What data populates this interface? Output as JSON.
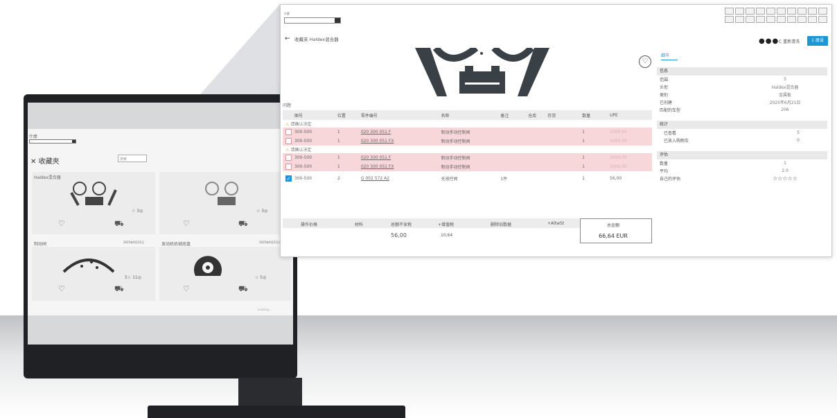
{
  "small_screen": {
    "dropdown_label": "什麼",
    "title": "收藏夾",
    "search_placeholder": "搜索",
    "cards": [
      {
        "title": "Haldex混合器",
        "stats": "☆ 3◎"
      },
      {
        "title": "",
        "stats": "☆ 3◎"
      },
      {
        "title": "制动阀",
        "stats": "5☆ 11◎"
      },
      {
        "title": "发动机机械底盘",
        "stats": "☆ 5◎"
      }
    ],
    "dates": [
      "2025年6月21日",
      "2025年6月21日"
    ],
    "loading": "Loading..."
  },
  "window": {
    "dropdown_label": "什麼",
    "breadcrumb": "收藏夹 Haldex混合器",
    "more_dots": "●●●",
    "reset_label": "C 重新清洗",
    "primary_button": "1 册设",
    "table_caption": "问题",
    "columns": [
      "图号",
      "位置",
      "零件编号",
      "名称",
      "备注",
      "仓库",
      "存货",
      "数量",
      "UPE"
    ],
    "groups": [
      {
        "label": "请确认决定",
        "rows": [
          {
            "fig": "300-500",
            "pos": "1",
            "part": "020 300 051 F",
            "name": "制动手动控制阀",
            "qty": "1",
            "upe": "1000,00"
          },
          {
            "fig": "300-500",
            "pos": "1",
            "part": "020 300 051 FX",
            "name": "制动手动控制阀",
            "qty": "1",
            "upe": "1000,00"
          }
        ]
      },
      {
        "label": "请确认决定",
        "rows": [
          {
            "fig": "300-500",
            "pos": "1",
            "part": "020 300 051 F",
            "name": "制动手动控制阀",
            "qty": "1",
            "upe": "3000,00"
          },
          {
            "fig": "300-500",
            "pos": "1",
            "part": "020 300 051 FX",
            "name": "制动手动控制阀",
            "qty": "1",
            "upe": "3000,00"
          }
        ]
      }
    ],
    "selected_row": {
      "fig": "300-500",
      "pos": "2",
      "part": "G 002 572 A2",
      "name": "无液控阀",
      "note": "1件",
      "qty": "1",
      "upe": "56,00"
    },
    "summary_headers": [
      "操作价格",
      "材料",
      "总额不含税",
      "+增值税",
      "删除旧数据",
      "+AltwSt",
      "总金额"
    ],
    "summary_values": {
      "net": "56,00",
      "vat": "10,64",
      "total": "66,64 EUR"
    },
    "detail_tab": "细节",
    "info_section": "信息",
    "info": [
      {
        "k": "范围",
        "v": "5"
      },
      {
        "k": "头衔",
        "v": "Haldex混合器"
      },
      {
        "k": "类别",
        "v": "金属板"
      },
      {
        "k": "已创建",
        "v": "2025年6月21日"
      },
      {
        "k": "匹配的车型",
        "v": "206"
      }
    ],
    "stats_section": "统计",
    "stats": [
      {
        "k": "已查看",
        "v": "5"
      },
      {
        "k": "已放入购物车",
        "v": "0"
      }
    ],
    "rating_section": "评估",
    "rating": [
      {
        "k": "数量",
        "v": "1"
      },
      {
        "k": "平均",
        "v": "2.0"
      },
      {
        "k": "自己的评估",
        "v": "☆☆☆☆☆"
      }
    ]
  }
}
